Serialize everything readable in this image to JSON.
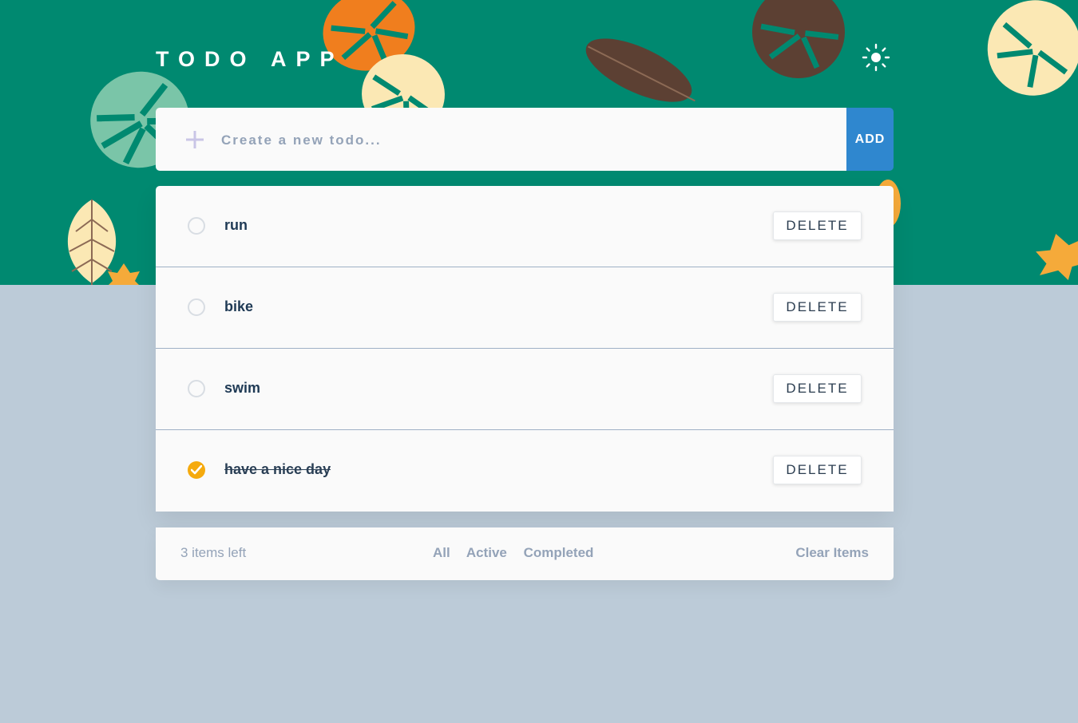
{
  "header": {
    "title": "TODO APP",
    "theme_icon": "sun-icon"
  },
  "new_todo": {
    "placeholder": "Create a new todo...",
    "value": "",
    "add_label": "ADD",
    "plus_icon": "plus-icon"
  },
  "todos": [
    {
      "text": "run",
      "completed": false,
      "delete_label": "DELETE"
    },
    {
      "text": "bike",
      "completed": false,
      "delete_label": "DELETE"
    },
    {
      "text": "swim",
      "completed": false,
      "delete_label": "DELETE"
    },
    {
      "text": "have a nice day",
      "completed": true,
      "delete_label": "DELETE"
    }
  ],
  "footer": {
    "items_left": "3 items left",
    "filters": [
      "All",
      "Active",
      "Completed"
    ],
    "clear_label": "Clear Items"
  },
  "colors": {
    "header_bg": "#008970",
    "page_bg": "#bccbd8",
    "add_button": "#2f87cf",
    "check_done": "#f5aa0e",
    "muted_text": "#94a3b8"
  }
}
